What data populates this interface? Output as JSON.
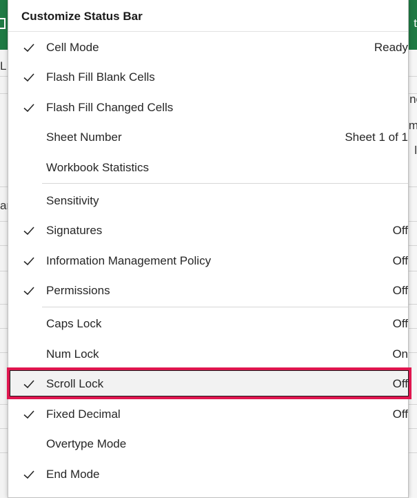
{
  "menu": {
    "title": "Customize Status Bar",
    "items": [
      {
        "label": "Cell Mode",
        "value": "Ready",
        "checked": true
      },
      {
        "label": "Flash Fill Blank Cells",
        "value": "",
        "checked": true
      },
      {
        "label": "Flash Fill Changed Cells",
        "value": "",
        "checked": true
      },
      {
        "label": "Sheet Number",
        "value": "Sheet 1 of 1",
        "checked": false
      },
      {
        "label": "Workbook Statistics",
        "value": "",
        "checked": false
      },
      {
        "label": "Sensitivity",
        "value": "",
        "checked": false
      },
      {
        "label": "Signatures",
        "value": "Off",
        "checked": true
      },
      {
        "label": "Information Management Policy",
        "value": "Off",
        "checked": true
      },
      {
        "label": "Permissions",
        "value": "Off",
        "checked": true
      },
      {
        "label": "Caps Lock",
        "value": "Off",
        "checked": false
      },
      {
        "label": "Num Lock",
        "value": "On",
        "checked": false
      },
      {
        "label": "Scroll Lock",
        "value": "Off",
        "checked": true,
        "highlighted": true
      },
      {
        "label": "Fixed Decimal",
        "value": "Off",
        "checked": true
      },
      {
        "label": "Overtype Mode",
        "value": "",
        "checked": false
      },
      {
        "label": "End Mode",
        "value": "",
        "checked": true
      }
    ]
  },
  "background": {
    "ribbon_color": "#1f7a44",
    "right_ribbon_text": "t",
    "left_glyphs": [
      "L",
      "ar"
    ],
    "right_glyphs": [
      "no",
      "m",
      "l"
    ]
  },
  "colors": {
    "highlight": "#e0164f",
    "check": "#262626"
  }
}
